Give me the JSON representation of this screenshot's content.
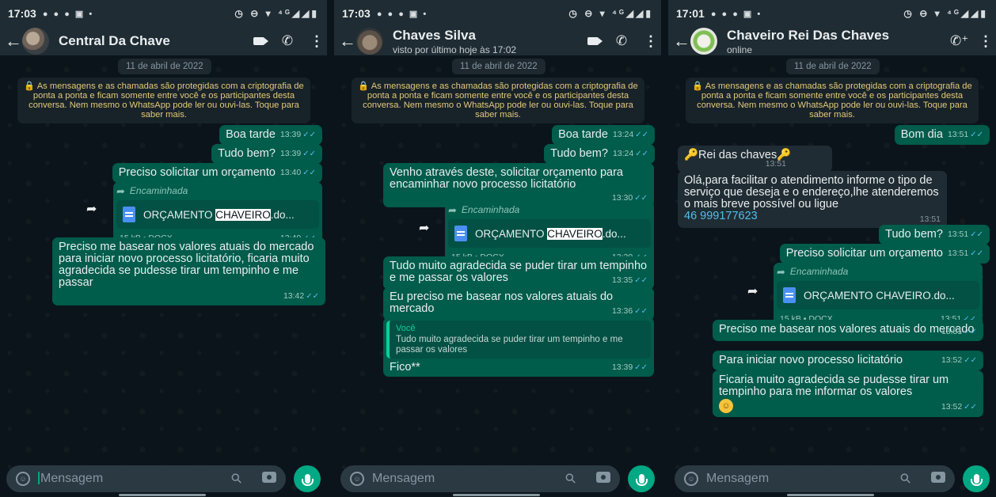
{
  "panels": [
    {
      "status": {
        "time": "17:03",
        "notif_icons": "● ● ● ▣ •",
        "right_icons": "◷ ⊖ ▾ ⁴ᴳ◢◢▮"
      },
      "contact": {
        "name": "Central Da Chave",
        "subtitle": ""
      },
      "date_chip": "11 de abril de 2022",
      "system_notice": "As mensagens e as chamadas são protegidas com a criptografia de ponta a ponta e ficam somente entre você e os participantes desta conversa. Nem mesmo o WhatsApp pode ler ou ouvi-las. Toque para saber mais.",
      "messages": [
        {
          "text": "Boa tarde",
          "time": "13:39"
        },
        {
          "text": "Tudo bem?",
          "time": "13:39"
        },
        {
          "text": "Preciso solicitar um orçamento",
          "time": "13:40"
        },
        {
          "forwarded_label": "Encaminhada",
          "doc_name_pre": "ORÇAMENTO ",
          "doc_name_hl": "CHAVEIRO",
          "doc_name_post": ".do...",
          "doc_info": "15 kB • DOCX",
          "time": "13:40"
        },
        {
          "text": "Preciso me basear nos valores atuais do mercado para iniciar novo processo licitatório, ficaria muito agradecida se pudesse tirar um tempinho e me passar",
          "time": "13:42"
        }
      ],
      "input_placeholder": "Mensagem"
    },
    {
      "status": {
        "time": "17:03",
        "notif_icons": "● ● ● ▣ •",
        "right_icons": "◷ ⊖ ▾ ⁴ᴳ◢◢▮"
      },
      "contact": {
        "name": "Chaves Silva",
        "subtitle": "visto por último hoje às 17:02"
      },
      "date_chip": "11 de abril de 2022",
      "system_notice": "As mensagens e as chamadas são protegidas com a criptografia de ponta a ponta e ficam somente entre você e os participantes desta conversa. Nem mesmo o WhatsApp pode ler ou ouvi-las. Toque para saber mais.",
      "messages": [
        {
          "text": "Boa tarde",
          "time": "13:24"
        },
        {
          "text": "Tudo bem?",
          "time": "13:24"
        },
        {
          "text": "Venho através deste, solicitar orçamento para encaminhar novo processo licitatório",
          "time": "13:30"
        },
        {
          "forwarded_label": "Encaminhada",
          "doc_name_pre": "ORÇAMENTO ",
          "doc_name_hl": "CHAVEIRO",
          "doc_name_post": ".do...",
          "doc_info": "15 kB • DOCX",
          "time": "13:30"
        },
        {
          "text": "Tudo muito agradecida se puder tirar um tempinho e me passar os valores",
          "time": "13:35"
        },
        {
          "text": "Eu preciso me basear nos valores atuais do mercado",
          "time": "13:36"
        },
        {
          "quote_author": "Você",
          "quote_text": "Tudo muito agradecida se puder tirar um tempinho e me passar os valores",
          "text": "Fico**",
          "time": "13:39"
        }
      ],
      "input_placeholder": "Mensagem"
    },
    {
      "status": {
        "time": "17:01",
        "notif_icons": "● ● ● ▣ •",
        "right_icons": "◷ ⊖ ▾ ⁴ᴳ◢◢▮"
      },
      "contact": {
        "name": "Chaveiro Rei Das Chaves",
        "subtitle": "online"
      },
      "date_chip": "11 de abril de 2022",
      "system_notice": "As mensagens e as chamadas são protegidas com a criptografia de ponta a ponta e ficam somente entre você e os participantes desta conversa. Nem mesmo o WhatsApp pode ler ou ouvi-las. Toque para saber mais.",
      "messages": [
        {
          "text": "Bom dia",
          "time": "13:51"
        },
        {
          "text": "🔑Rei das chaves🔑",
          "time": "13:51"
        },
        {
          "text": "Olá,para facilitar o atendimento informe o tipo de serviço que deseja e o endereço,lhe atenderemos o mais breve possível ou ligue",
          "link": "46 999177623",
          "time": "13:51"
        },
        {
          "text": "Tudo bem?",
          "time": "13:51"
        },
        {
          "text": "Preciso solicitar um orçamento",
          "time": "13:51"
        },
        {
          "forwarded_label": "Encaminhada",
          "doc_name": "ORÇAMENTO CHAVEIRO.do...",
          "doc_info": "15 kB • DOCX",
          "time": "13:51"
        },
        {
          "text": "Preciso me basear nos valores atuais do mercado",
          "time": "13:51"
        },
        {
          "text": "Para iniciar novo processo licitatório",
          "time": "13:52"
        },
        {
          "text": "Ficaria muito agradecida se pudesse tirar um tempinho para me informar os valores",
          "time": "13:52"
        }
      ],
      "input_placeholder": "Mensagem"
    }
  ]
}
